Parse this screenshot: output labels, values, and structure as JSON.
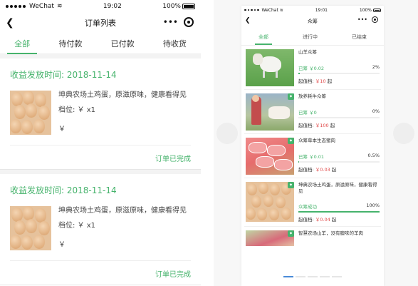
{
  "left": {
    "status": {
      "carrier": "WeChat",
      "time": "19:02",
      "battery": "100%"
    },
    "nav": {
      "title": "订单列表",
      "more": "•••"
    },
    "tabs": [
      "全部",
      "待付款",
      "已付款",
      "待收货"
    ],
    "orders": [
      {
        "date": "收益发放时间: 2018-11-14",
        "title": "坤典农场土鸡蛋，原滋原味，健康看得见",
        "price": "档位: ￥ x1",
        "yen": "￥",
        "status": "订单已完成"
      },
      {
        "date": "收益发放时间: 2018-11-14",
        "title": "坤典农场土鸡蛋，原滋原味，健康看得见",
        "price": "档位: ￥ x1",
        "yen": "￥",
        "status": "订单已完成"
      }
    ]
  },
  "right": {
    "status": {
      "carrier": "WeChat",
      "time": "19:01",
      "battery": "100%"
    },
    "nav": {
      "title": "众筹",
      "more": "•••"
    },
    "tabs": [
      "全部",
      "进行中",
      "已结束"
    ],
    "items": [
      {
        "title": "山羊众筹",
        "raised": "已筹 ￥0.02",
        "pct": "2%",
        "progress": 0.02,
        "min_label": "起值档:",
        "min_amt": "￥10",
        "min_suffix": "起",
        "badge": false
      },
      {
        "title": "放养耗牛众筹",
        "raised": "已筹 ￥0",
        "pct": "0%",
        "progress": 0,
        "min_label": "起值档:",
        "min_amt": "￥100",
        "min_suffix": "起",
        "badge": true
      },
      {
        "title": "众筹草本生态猪肉",
        "raised": "已筹 ￥0.01",
        "pct": "0.5%",
        "progress": 0.005,
        "min_label": "起值档:",
        "min_amt": "￥0.03",
        "min_suffix": "起",
        "badge": true
      },
      {
        "title": "坤典农场土鸡蛋，原滋原味，健康看得见",
        "raised": "众筹成功",
        "pct": "100%",
        "progress": 1,
        "min_label": "起值档:",
        "min_amt": "￥0.04",
        "min_suffix": "起",
        "badge": true
      },
      {
        "title": "智慧农场山羊，没有膻味的羊肉",
        "raised": "",
        "pct": "",
        "progress": 0,
        "min_label": "",
        "min_amt": "",
        "min_suffix": "",
        "badge": true
      }
    ]
  }
}
